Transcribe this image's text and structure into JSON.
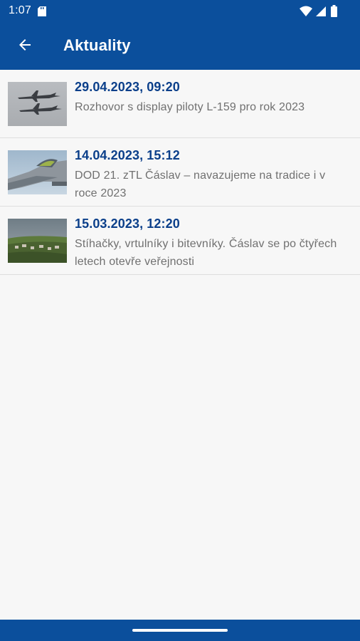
{
  "status_bar": {
    "time": "1:07",
    "icons": [
      "sd-card-icon",
      "wifi-icon",
      "cell-signal-icon",
      "battery-icon"
    ]
  },
  "app_bar": {
    "back_icon": "arrow-back-icon",
    "title": "Aktuality"
  },
  "news": [
    {
      "date": "29.04.2023, 09:20",
      "title": "Rozhovor s display piloty L-159 pro rok 2023",
      "thumbnail": "two-jets-formation-image"
    },
    {
      "date": "14.04.2023, 15:12",
      "title": "DOD 21. zTL Čáslav – navazujeme na tradice i v roce 2023",
      "thumbnail": "gripen-cockpit-image"
    },
    {
      "date": "15.03.2023, 12:20",
      "title": "Stíhačky, vrtulníky i bitevníky. Čáslav se po čtyřech letech otevře veřejnosti",
      "thumbnail": "landscape-town-image"
    }
  ],
  "colors": {
    "primary": "#0b4f9c",
    "date_text": "#0b3f8a",
    "body_text": "#707070",
    "background": "#f7f7f7"
  }
}
